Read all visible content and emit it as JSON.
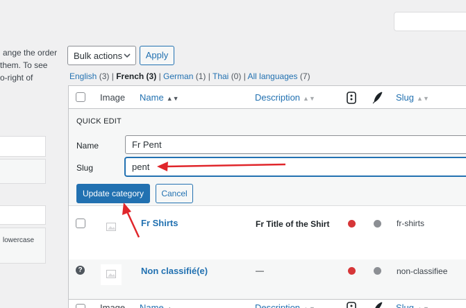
{
  "left_panel": {
    "note_lines": [
      "ange the order",
      "them. To see",
      "o-right of"
    ],
    "description_hint": "lowercase"
  },
  "toolbar": {
    "bulk_actions_label": "Bulk actions",
    "apply_label": "Apply"
  },
  "languages": {
    "english": "English",
    "english_count": "(3)",
    "french": "French",
    "french_count": "(3)",
    "german": "German",
    "german_count": "(1)",
    "thai": "Thai",
    "thai_count": "(0)",
    "all": "All languages",
    "all_count": "(7)",
    "sep": "|"
  },
  "table": {
    "headers": {
      "image": "Image",
      "name": "Name",
      "description": "Description",
      "slug": "Slug"
    },
    "quick_edit": {
      "title": "QUICK EDIT",
      "name_label": "Name",
      "name_value": "Fr Pent",
      "slug_label": "Slug",
      "slug_value": "pent",
      "update_label": "Update category",
      "cancel_label": "Cancel"
    },
    "rows": [
      {
        "name": "Fr Shirts",
        "description": "Fr Title of the Shirt",
        "slug": "fr-shirts"
      },
      {
        "name": "Non classifié(e)",
        "description": "—",
        "slug": "non-classifiee"
      }
    ]
  },
  "colors": {
    "accent": "#2271b1",
    "arrow": "#e0262b",
    "status_red": "#d63638",
    "status_gray": "#8c8f94"
  },
  "icons": [
    "chevron-down-icon",
    "sort-icon",
    "mobile-icon",
    "quill-icon",
    "image-placeholder-icon",
    "help-icon"
  ]
}
